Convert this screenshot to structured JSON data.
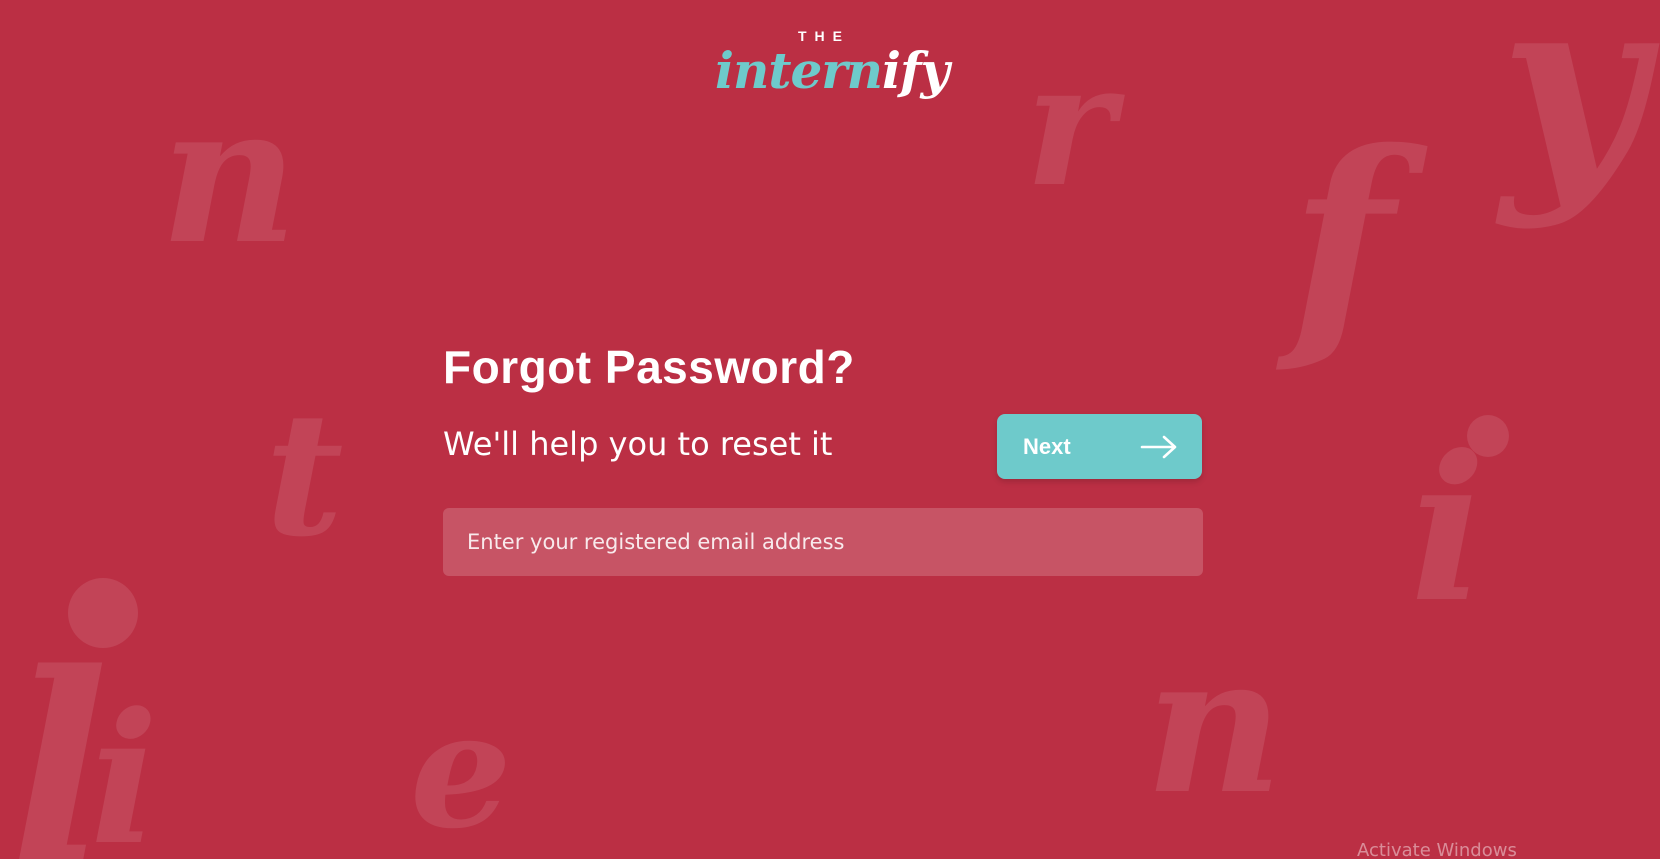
{
  "logo": {
    "the": "THE",
    "word_part1": "intern",
    "word_part2": "ify",
    "accent_color": "#6ecacb"
  },
  "background": {
    "color": "#bb2f44",
    "decor_letters": [
      "n",
      "r",
      "y",
      "f",
      "t",
      "i",
      "l",
      "e",
      "n",
      "i"
    ]
  },
  "form": {
    "title": "Forgot Password?",
    "subtitle": "We'll help you to reset it",
    "next_button": {
      "label": "Next",
      "icon": "arrow-right-icon",
      "color": "#6ecacb"
    },
    "email_input": {
      "placeholder": "Enter your registered email address",
      "value": ""
    }
  },
  "system_watermark": "Activate Windows"
}
